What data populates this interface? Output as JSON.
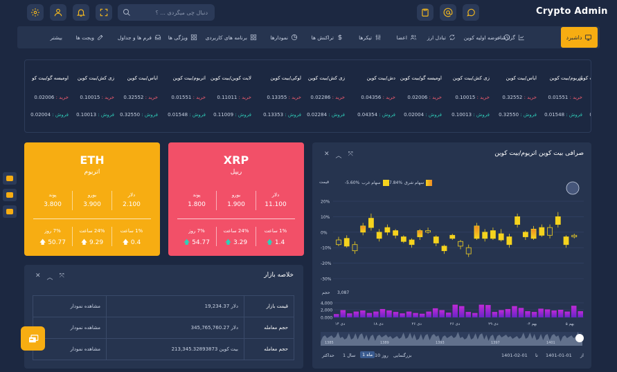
{
  "app": {
    "brand": "Crypto Admin"
  },
  "topbar": {
    "search_placeholder": "دنبال چی میگردی ... ؟",
    "icons_left": [
      "settings-icon",
      "user-icon",
      "bell-icon",
      "fullscreen-icon",
      "search-icon"
    ],
    "icons_right": [
      "clipboard-icon",
      "at-icon",
      "chat-icon"
    ]
  },
  "nav": {
    "active_label": "داشبرد",
    "items": [
      "گزارشات",
      "عرضه اولیه کوین",
      "تبادل ارز",
      "اعضا",
      "تیکرها",
      "تراکنش ها",
      "نمودارها",
      "برنامه های کاربردی",
      "ویژگی ها",
      "فرم ها و جداول",
      "ویجت ها",
      "بیشتر"
    ]
  },
  "ticker": {
    "buy_label": "خرید :",
    "sell_label": "فروش :",
    "items": [
      {
        "pair": "ت کوین",
        "buy": "",
        "sell": "0."
      },
      {
        "pair": "اتریوم/بیت کوین",
        "buy": "0.01551",
        "sell": "0.01548"
      },
      {
        "pair": "ایاس/بیت کوین",
        "buy": "0.32552",
        "sell": "0.32550"
      },
      {
        "pair": "زی کش/بیت کوین",
        "buy": "0.10015",
        "sell": "0.10013"
      },
      {
        "pair": "اومیسه گو/بیت کوین",
        "buy": "0.02006",
        "sell": "0.02004"
      },
      {
        "pair": "دش/بیت کوین",
        "buy": "0.04356",
        "sell": "0.04354"
      },
      {
        "pair": "زی کش/بیت کوین",
        "buy": "0.02286",
        "sell": "0.02284"
      },
      {
        "pair": "لوکی/بیت کوین",
        "buy": "0.13355",
        "sell": "0.13353"
      },
      {
        "pair": "لایت کوین/بیت کوین",
        "buy": "0.11011",
        "sell": "0.11009"
      },
      {
        "pair": "اتریوم/بیت کوین",
        "buy": "0.01551",
        "sell": "0.01548"
      },
      {
        "pair": "ایاس/بیت کوین",
        "buy": "0.32552",
        "sell": "0.32550"
      },
      {
        "pair": "زی کش/بیت کوین",
        "buy": "0.10015",
        "sell": "0.10013"
      },
      {
        "pair": "اومیسه گو/بیت کو",
        "buy": "0.02006",
        "sell": "0.02004"
      }
    ]
  },
  "cards": [
    {
      "symbol": "ETH",
      "name": "اتریوم",
      "color": "#f7ad12",
      "prices": [
        {
          "label": "دلار",
          "value": "2.100"
        },
        {
          "label": "یورو",
          "value": "3.900"
        },
        {
          "label": "پوند",
          "value": "3.800"
        }
      ],
      "changes": [
        {
          "label": "1% ساعت",
          "value": "0.4"
        },
        {
          "label": "24% ساعت",
          "value": "9.29"
        },
        {
          "label": "7% روز",
          "value": "50.77"
        }
      ]
    },
    {
      "symbol": "XRP",
      "name": "ریپل",
      "color": "#f25068",
      "prices": [
        {
          "label": "دلار",
          "value": "11.100"
        },
        {
          "label": "یورو",
          "value": "1.900"
        },
        {
          "label": "پوند",
          "value": "1.800"
        }
      ],
      "changes": [
        {
          "label": "1% ساعت",
          "value": "1.4"
        },
        {
          "label": "24% ساعت",
          "value": "3.29"
        },
        {
          "label": "7% روز",
          "value": "54.77"
        }
      ]
    }
  ],
  "summary": {
    "title": "خلاصه بازار",
    "action": "مشاهده نمودار",
    "rows": [
      {
        "key": "قیمت بازار",
        "value": "19,234.37 دلار"
      },
      {
        "key": "حجم معامله",
        "value": "345,765,760.27 دلار"
      },
      {
        "key": "حجم معامله",
        "value": "213,345.32893873 بیت کوین"
      }
    ]
  },
  "chart_panel": {
    "title": "صرافی بیت کوین اتریوم/بیت کوین",
    "legend": [
      {
        "label": "7.84%",
        "name": "سهام شرق",
        "color": "#f08a24"
      },
      {
        "label": "-5.60%",
        "name": "سهام غرب",
        "color": "#f5d31e"
      },
      {
        "label": "قیمت",
        "name": "",
        "color": ""
      }
    ],
    "range": {
      "zoom_label": "بزرگنمایی",
      "zoom_options": [
        "10 روز",
        "1 ماه",
        "1 سال",
        "حداکثر"
      ],
      "active_option": "1 ماه",
      "from_date": "1401-01-01",
      "to_label": "تا",
      "to_date": "1401-02-01",
      "right_label": "از"
    }
  },
  "chart_data": {
    "type": "candlestick",
    "y_ticks": [
      "20%",
      "10%",
      "0%",
      "-10%",
      "-20%",
      "-30%"
    ],
    "ylim": [
      -30,
      25
    ],
    "volume_label": "حجم",
    "volume_readout": "3,087",
    "volume_ticks": [
      "4,000",
      "2,000",
      "0.000"
    ],
    "x_ticks": [
      "بهم ۵",
      "بهم ۰۴",
      "دی ۲۹",
      "دی ۲۶",
      "دی ۲۶",
      "دی ۱۸",
      "دی ۱۴"
    ],
    "navigator_ticks": [
      "1401",
      "1397",
      "1393",
      "1389",
      "1385"
    ],
    "candles": [
      {
        "o": -5,
        "c": -8,
        "h": -3,
        "l": -9
      },
      {
        "o": -9,
        "c": -4,
        "h": -2,
        "l": -10
      },
      {
        "o": -8,
        "c": -12,
        "h": -6,
        "l": -14
      },
      {
        "o": 4,
        "c": 0,
        "h": 6,
        "l": -2
      },
      {
        "o": 3,
        "c": 9,
        "h": 12,
        "l": 1
      },
      {
        "o": -4,
        "c": 0,
        "h": 2,
        "l": -6
      },
      {
        "o": 0,
        "c": 3,
        "h": 5,
        "l": -2
      },
      {
        "o": -2,
        "c": 1,
        "h": 2,
        "l": -4
      },
      {
        "o": -6,
        "c": -3,
        "h": -2,
        "l": -7
      },
      {
        "o": -8,
        "c": -5,
        "h": -4,
        "l": -10
      },
      {
        "o": -3,
        "c": 1,
        "h": 2,
        "l": -5
      },
      {
        "o": 1,
        "c": 0,
        "h": 3,
        "l": -1
      },
      {
        "o": -7,
        "c": -3,
        "h": -2,
        "l": -9
      },
      {
        "o": -12,
        "c": -9,
        "h": -8,
        "l": -14
      },
      {
        "o": -4,
        "c": -2,
        "h": -1,
        "l": -5
      },
      {
        "o": -6,
        "c": -9,
        "h": -5,
        "l": -11
      },
      {
        "o": -10,
        "c": -14,
        "h": -8,
        "l": -16
      },
      {
        "o": -4,
        "c": 4,
        "h": 6,
        "l": -5
      },
      {
        "o": -4,
        "c": 0,
        "h": 2,
        "l": -6
      },
      {
        "o": -4,
        "c": 1,
        "h": 3,
        "l": -5
      },
      {
        "o": -5,
        "c": -1,
        "h": 2,
        "l": -6
      },
      {
        "o": -8,
        "c": -3,
        "h": -1,
        "l": -10
      },
      {
        "o": 5,
        "c": 10,
        "h": 12,
        "l": 3
      },
      {
        "o": -3,
        "c": 0,
        "h": 1,
        "l": -5
      },
      {
        "o": -4,
        "c": 2,
        "h": 4,
        "l": -5
      },
      {
        "o": -2,
        "c": 3,
        "h": 5,
        "l": -3
      },
      {
        "o": 3,
        "c": -2,
        "h": 5,
        "l": -4
      },
      {
        "o": 5,
        "c": 10,
        "h": 13,
        "l": 3
      },
      {
        "o": -8,
        "c": -3,
        "h": -2,
        "l": -10
      },
      {
        "o": -2,
        "c": -3,
        "h": -1,
        "l": -4
      }
    ],
    "volumes": [
      900,
      2000,
      1100,
      1600,
      1900,
      1200,
      1600,
      2300,
      1900,
      1500,
      1100,
      1600,
      1200,
      1000,
      1600,
      2500,
      2000,
      1300,
      3500,
      3100,
      1500,
      1200,
      3500,
      3400,
      1500,
      2000,
      2300,
      3100,
      2600,
      1700,
      1500,
      2400,
      2200,
      1900,
      2100,
      1600,
      3200,
      1700
    ]
  }
}
